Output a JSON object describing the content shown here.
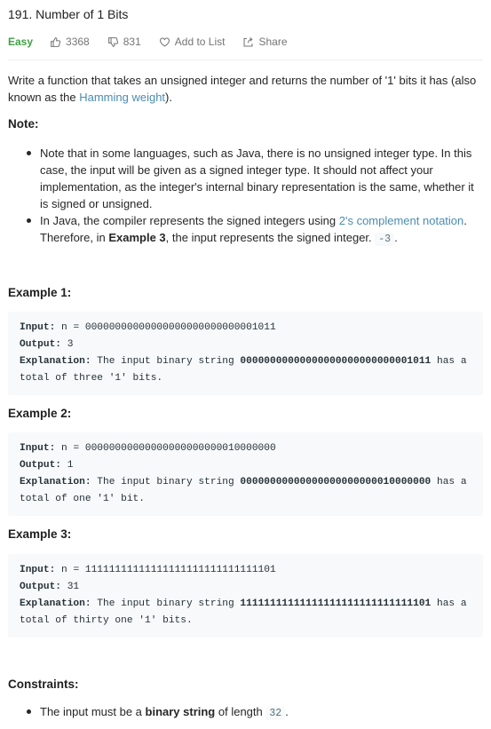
{
  "problem": {
    "title": "191. Number of 1 Bits",
    "difficulty": "Easy",
    "likes": "3368",
    "dislikes": "831",
    "add_to_list": "Add to List",
    "share": "Share"
  },
  "description": {
    "intro_before": "Write a function that takes an unsigned integer and returns the number of '1' bits it has (also known as the ",
    "intro_link": "Hamming weight",
    "intro_after": ").",
    "note_heading": "Note:",
    "note1": "Note that in some languages, such as Java, there is no unsigned integer type. In this case, the input will be given as a signed integer type. It should not affect your implementation, as the integer's internal binary representation is the same, whether it is signed or unsigned.",
    "note2_before": "In Java, the compiler represents the signed integers using ",
    "note2_link": "2's complement notation",
    "note2_mid": ". Therefore, in ",
    "note2_bold": "Example 3",
    "note2_after": ", the input represents the signed integer. ",
    "note2_code": "-3",
    "note2_end": "."
  },
  "examples": [
    {
      "heading": "Example 1:",
      "input_label": "Input:",
      "input_value": " n = 00000000000000000000000000001011",
      "output_label": "Output:",
      "output_value": " 3",
      "explanation_label": "Explanation:",
      "explanation_before": " The input binary string ",
      "explanation_bold": "00000000000000000000000000001011",
      "explanation_after": " has a",
      "explanation_line2": "total of three '1' bits."
    },
    {
      "heading": "Example 2:",
      "input_label": "Input:",
      "input_value": " n = 00000000000000000000000010000000",
      "output_label": "Output:",
      "output_value": " 1",
      "explanation_label": "Explanation:",
      "explanation_before": " The input binary string ",
      "explanation_bold": "00000000000000000000000010000000",
      "explanation_after": " has a",
      "explanation_line2": "total of one '1' bit."
    },
    {
      "heading": "Example 3:",
      "input_label": "Input:",
      "input_value": " n = 11111111111111111111111111111101",
      "output_label": "Output:",
      "output_value": " 31",
      "explanation_label": "Explanation:",
      "explanation_before": " The input binary string ",
      "explanation_bold": "11111111111111111111111111111101",
      "explanation_after": " has a",
      "explanation_line2": "total of thirty one '1' bits."
    }
  ],
  "constraints": {
    "heading": "Constraints:",
    "item_before": "The input must be a ",
    "item_bold": "binary string",
    "item_mid": " of length ",
    "item_code": "32",
    "item_end": "."
  }
}
